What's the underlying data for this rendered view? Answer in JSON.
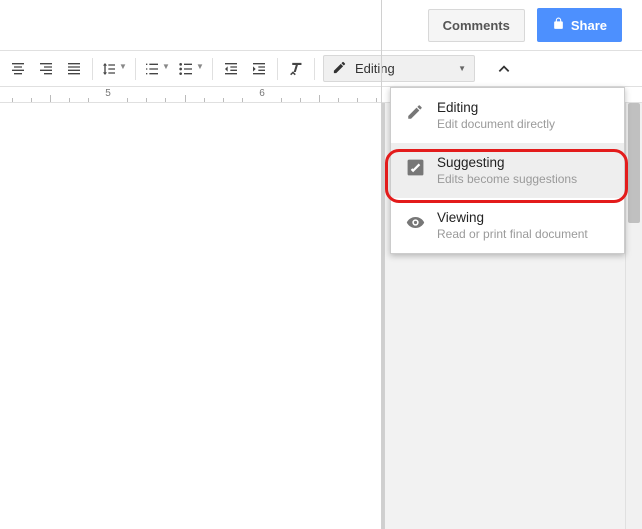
{
  "top": {
    "comments_label": "Comments",
    "share_label": "Share"
  },
  "toolbar": {
    "mode_label": "Editing"
  },
  "ruler": {
    "labels": [
      "5",
      "6"
    ]
  },
  "mode_menu": {
    "items": [
      {
        "title": "Editing",
        "desc": "Edit document directly",
        "icon": "pencil-icon"
      },
      {
        "title": "Suggesting",
        "desc": "Edits become suggestions",
        "icon": "suggest-icon"
      },
      {
        "title": "Viewing",
        "desc": "Read or print final document",
        "icon": "eye-icon"
      }
    ]
  },
  "annotation": {
    "target": "suggesting-mode-item"
  }
}
